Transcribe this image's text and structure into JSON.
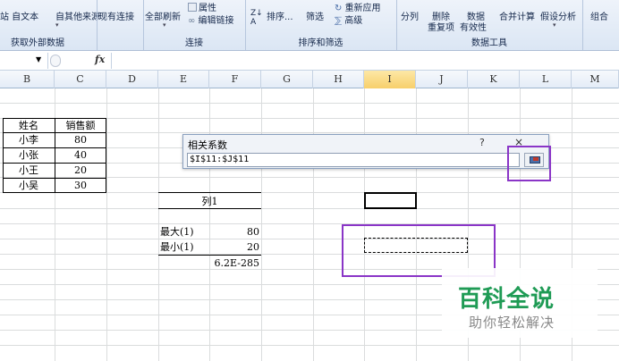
{
  "ribbon": {
    "buttons": [
      {
        "label": "站 自文本",
        "name": "from-text-button"
      },
      {
        "label": "自其他来源",
        "name": "from-other-sources-button"
      },
      {
        "label": "现有连接",
        "name": "existing-connections-button"
      },
      {
        "label": "全部刷新",
        "name": "refresh-all-button"
      },
      {
        "label": "属性",
        "name": "properties-button"
      },
      {
        "label": "编辑链接",
        "name": "edit-links-button"
      },
      {
        "label": "排序...",
        "name": "sort-button"
      },
      {
        "label": "筛选",
        "name": "filter-button"
      },
      {
        "label": "重新应用",
        "name": "reapply-button"
      },
      {
        "label": "高级",
        "name": "advanced-button"
      },
      {
        "label": "分列",
        "name": "text-to-columns-button"
      },
      {
        "label": "删除",
        "name": "remove-duplicates-button"
      },
      {
        "label": "重复项",
        "name": "remove-duplicates-label2"
      },
      {
        "label": "数据",
        "name": "data-validation-button"
      },
      {
        "label": "有效性",
        "name": "data-validation-label2"
      },
      {
        "label": "合并计算",
        "name": "consolidate-button"
      },
      {
        "label": "假设分析",
        "name": "what-if-button"
      },
      {
        "label": "组合",
        "name": "group-button"
      }
    ],
    "groups": [
      "获取外部数据",
      "连接",
      "排序和筛选",
      "数据工具"
    ]
  },
  "formula_bar": {
    "fx": "fx",
    "name_box": "",
    "value": ""
  },
  "columns": [
    "B",
    "C",
    "D",
    "E",
    "F",
    "G",
    "H",
    "I",
    "J",
    "K",
    "L",
    "M"
  ],
  "active_column": "I",
  "table": {
    "headers": [
      "姓名",
      "销售额"
    ],
    "rows": [
      [
        "小李",
        "80"
      ],
      [
        "小张",
        "40"
      ],
      [
        "小王",
        "20"
      ],
      [
        "小吴",
        "30"
      ]
    ]
  },
  "stats": {
    "header": "列1",
    "max_label": "最大(1)",
    "max_value": "80",
    "min_label": "最小(1)",
    "min_value": "20",
    "extra_value": "6.2E-285"
  },
  "dialog": {
    "title": "相关系数",
    "help": "?",
    "close": "×",
    "input_value": "$I$11:$J$11"
  },
  "watermark": {
    "title": "百科全说",
    "subtitle": "助你轻松解决"
  },
  "colors": {
    "accent_box": "#8a35c7",
    "watermark_green": "#1f9b55"
  }
}
